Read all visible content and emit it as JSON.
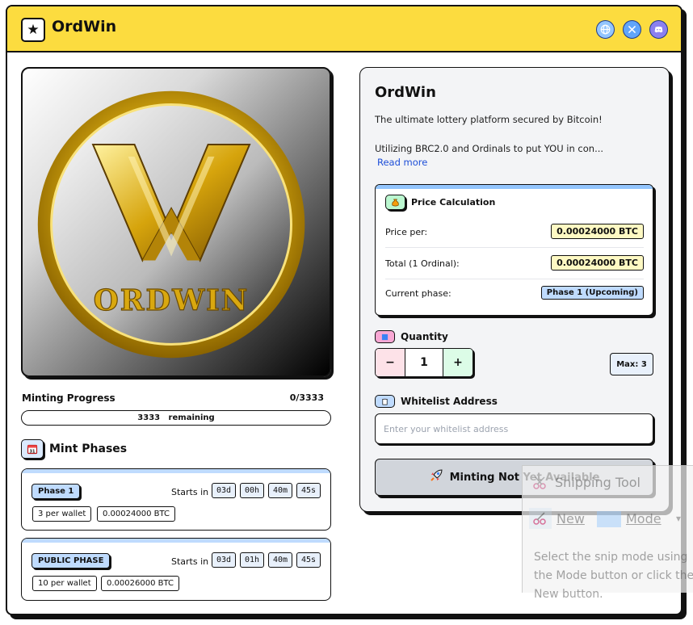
{
  "header": {
    "logo_glyph": "★",
    "brand": "OrdWin",
    "social_icons": [
      "globe-icon",
      "x-icon",
      "discord-icon"
    ],
    "accent_color": "#fcdc3f"
  },
  "hero": {
    "logo_text": "ORDWIN",
    "logo_letter": "W"
  },
  "progress": {
    "label": "Minting Progress",
    "count": "0/3333",
    "remaining_text": "3333   remaining",
    "fraction_minted": 0
  },
  "phases": {
    "title": "Mint Phases",
    "items": [
      {
        "badge": "Phase 1",
        "starts_label": "Starts in",
        "countdown": [
          "03d",
          "00h",
          "40m",
          "45s"
        ],
        "per_wallet": "3 per wallet",
        "price": "0.00024000 BTC"
      },
      {
        "badge": "PUBLIC PHASE",
        "starts_label": "Starts in",
        "countdown": [
          "03d",
          "01h",
          "40m",
          "45s"
        ],
        "per_wallet": "10 per wallet",
        "price": "0.00026000 BTC"
      }
    ]
  },
  "panel": {
    "title": "OrdWin",
    "description_1": "The ultimate lottery platform secured by Bitcoin!",
    "description_2": "Utilizing BRC2.0 and Ordinals to put YOU in con...",
    "read_more": "Read more",
    "price_card": {
      "title": "Price Calculation",
      "price_per_label": "Price per:",
      "price_per_value": "0.00024000 BTC",
      "total_label": "Total (1 Ordinal):",
      "total_value": "0.00024000 BTC",
      "phase_label": "Current phase:",
      "phase_value": "Phase 1 (Upcoming)"
    },
    "quantity": {
      "label": "Quantity",
      "minus": "−",
      "value": "1",
      "plus": "+",
      "max": "Max: 3"
    },
    "whitelist": {
      "label": "Whitelist Address",
      "placeholder": "Enter your whitelist address"
    },
    "mint_button": "Minting Not Yet Available"
  },
  "snipping_tool": {
    "title": "Snipping Tool",
    "new_label": "New",
    "mode_label": "Mode",
    "hint": "Select the snip mode using the Mode button or click the New button."
  }
}
